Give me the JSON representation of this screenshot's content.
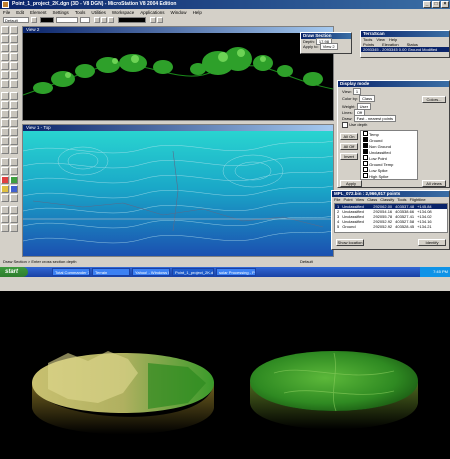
{
  "app": {
    "title": "Point_1_project_2K.dgn (3D - V8 DGN) - MicroStation V8 2004 Edition",
    "menu": [
      "File",
      "Edit",
      "Element",
      "Settings",
      "Tools",
      "Utilities",
      "Workspace",
      "Applications",
      "Window",
      "Help"
    ],
    "level_combo": "Default",
    "status_left": "Draw Section > Enter cross section depth",
    "status_right": "Default"
  },
  "views": {
    "view2_title": "View 2",
    "view1_title": "View 1 - Top"
  },
  "draw_section": {
    "title": "Draw Section",
    "depth_label": "Depth:",
    "depth_value": "17.98",
    "apply_label": "Apply to:",
    "apply_value": "View 2"
  },
  "terrascan": {
    "title": "TerraScan",
    "menu": [
      "Tools",
      "View",
      "Help"
    ],
    "columns": [
      "Points",
      "Elevation",
      "Status"
    ],
    "row": "2093345 - 2093345    0.00    Ground  Modified"
  },
  "display_mode": {
    "title": "Display mode",
    "view_label": "View:",
    "view_value": "1",
    "color_label": "Color by:",
    "color_value": "Class",
    "colors_button": "Colors...",
    "weight_label": "Weight:",
    "weight_value": "User",
    "lines_label": "Lines:",
    "lines_value": "Off",
    "draw_label": "Draw:",
    "draw_value": "Fast - nearest points",
    "depth_label": "Use depth",
    "classes": [
      "Temp",
      "Ground",
      "Non Ground",
      "Unclassified",
      "Low Point",
      "Ground Temp",
      "Low Spike",
      "High Spike"
    ],
    "all_on": "All On",
    "all_off": "All Off",
    "invert": "Invert",
    "apply": "Apply",
    "all_views": "All views"
  },
  "point_list": {
    "title": "MPL_072.bin : 2,966,917 points",
    "menu": [
      "File",
      "Point",
      "View",
      "Class",
      "Classify",
      "Tools",
      "Flightline"
    ],
    "rows": [
      {
        "num": "1",
        "cls": "Unclassified",
        "x": "292062.00",
        "y": "403537.48",
        "z": "+145.84"
      },
      {
        "num": "2",
        "cls": "Unclassified",
        "x": "292054.16",
        "y": "403538.66",
        "z": "+134.08"
      },
      {
        "num": "3",
        "cls": "Unclassified",
        "x": "292055.78",
        "y": "403527.41",
        "z": "+134.02"
      },
      {
        "num": "4",
        "cls": "Unclassified",
        "x": "292052.92",
        "y": "403527.58",
        "z": "+134.16"
      },
      {
        "num": "5",
        "cls": "Ground",
        "x": "292052.92",
        "y": "403528.45",
        "z": "+134.21"
      }
    ],
    "show_location": "Show location",
    "identify": "Identify"
  },
  "taskbar": {
    "start": "start",
    "tasks": [
      "Total Commander 7.0 ...",
      "Terrain",
      "Yahoo! - Windows Int...",
      "Point_1_project_2K.d...",
      "solar Processing - Paint"
    ],
    "clock": "7:45 PM"
  },
  "colors": {
    "title_blue": "#0a246a",
    "vegetation": "#2ea02a",
    "terrain_cyan": "#29d4d0",
    "terrain_blue": "#1b4fb0"
  }
}
